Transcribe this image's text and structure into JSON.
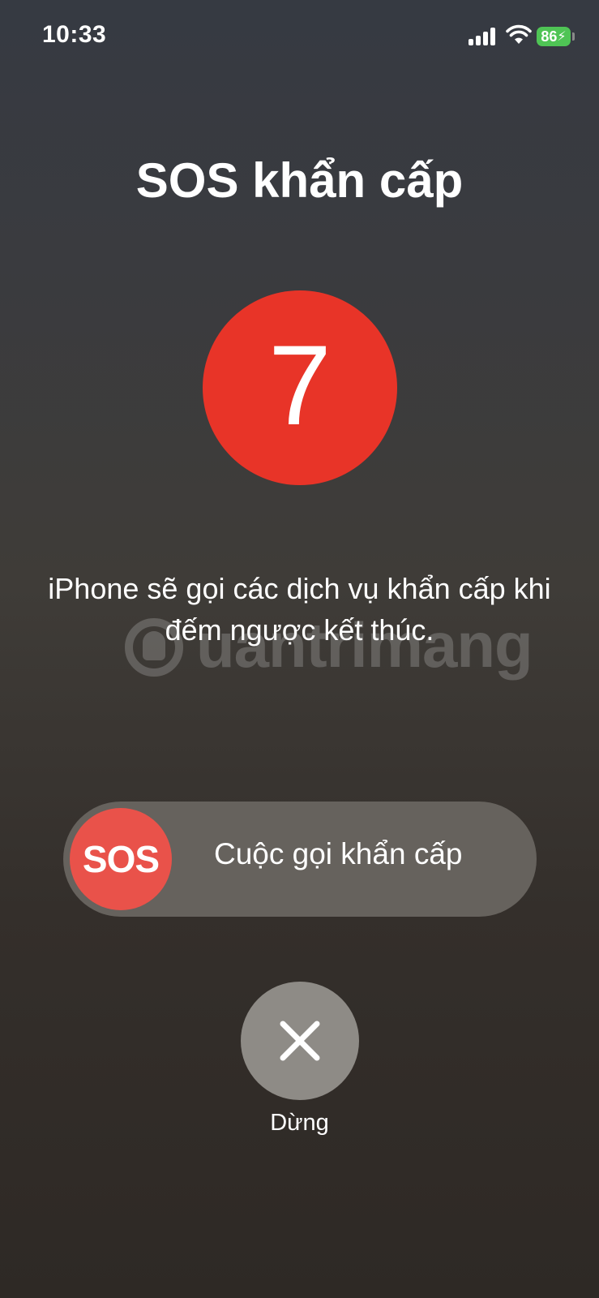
{
  "status_bar": {
    "time": "10:33",
    "battery": "86"
  },
  "screen": {
    "title": "SOS khẩn cấp",
    "countdown": "7",
    "message": "iPhone sẽ gọi các dịch vụ khẩn cấp khi đếm ngược kết thúc."
  },
  "watermark": {
    "text": "uantrimang"
  },
  "slider": {
    "knob_label": "SOS",
    "label": "Cuộc gọi khẩn cấp"
  },
  "stop": {
    "label": "Dừng"
  },
  "colors": {
    "countdown_red": "#e83428",
    "sos_knob_red": "#e9524a",
    "battery_green": "#4fc455"
  },
  "icons": {
    "signal": "cellular-signal-icon",
    "wifi": "wifi-icon",
    "battery": "battery-charging-icon",
    "stop": "close-icon"
  }
}
